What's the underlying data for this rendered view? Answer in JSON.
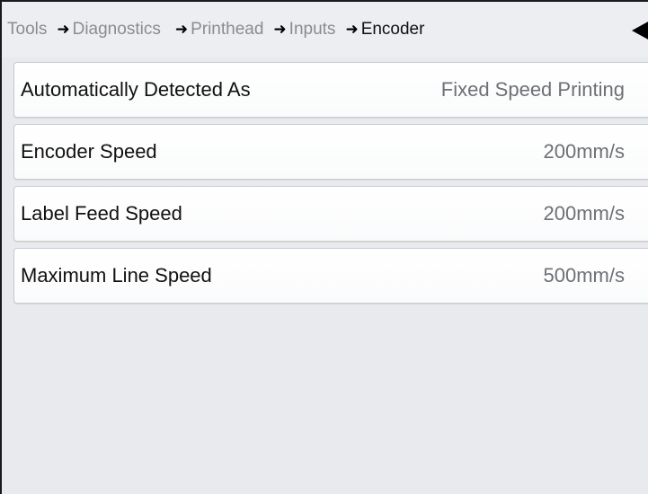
{
  "breadcrumb": {
    "items": [
      {
        "label": "Tools"
      },
      {
        "label": "Diagnostics"
      },
      {
        "label": "Printhead"
      },
      {
        "label": "Inputs"
      },
      {
        "label": "Encoder"
      }
    ],
    "separator_icon": "arrow-right-icon",
    "back_icon": "back-triangle-icon"
  },
  "rows": [
    {
      "label": "Automatically Detected As",
      "value": "Fixed Speed Printing"
    },
    {
      "label": "Encoder Speed",
      "value": "200mm/s"
    },
    {
      "label": "Label Feed Speed",
      "value": "200mm/s"
    },
    {
      "label": "Maximum Line Speed",
      "value": "500mm/s"
    }
  ],
  "colors": {
    "background": "#e8eaee",
    "row_background": "#ffffff",
    "label_text": "#111111",
    "value_text": "#6e7074",
    "breadcrumb_inactive": "#8a8c90"
  }
}
